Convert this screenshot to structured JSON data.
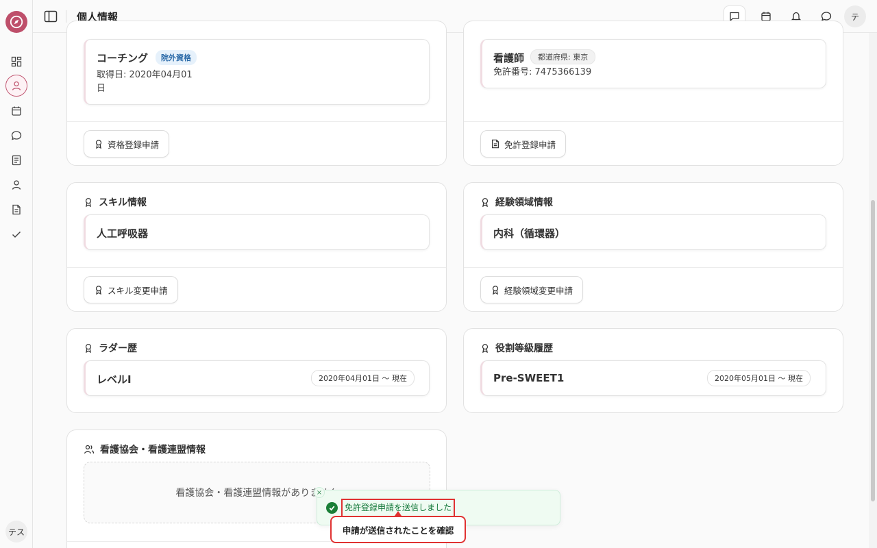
{
  "header": {
    "title": "個人情報",
    "user_initial": "テ"
  },
  "sidebar": {
    "user_label": "テス",
    "items": [
      {
        "icon": "dashboard-icon"
      },
      {
        "icon": "user-icon",
        "active": true
      },
      {
        "icon": "calendar-icon"
      },
      {
        "icon": "chat-icon"
      },
      {
        "icon": "book-icon"
      },
      {
        "icon": "person-icon"
      },
      {
        "icon": "document-icon"
      },
      {
        "icon": "check-icon"
      }
    ]
  },
  "cards": {
    "qualification": {
      "item_title": "コーチング",
      "badge": "院外資格",
      "date_line1": "取得日: 2020年04月01",
      "date_line2": "日",
      "button": "資格登録申請"
    },
    "license": {
      "item_title": "看護師",
      "badge": "都道府県: 東京",
      "number": "免許番号: 7475366139",
      "button": "免許登録申請"
    },
    "skill": {
      "title": "スキル情報",
      "item": "人工呼吸器",
      "button": "スキル変更申請"
    },
    "experience": {
      "title": "経験領域情報",
      "item": "内科（循環器）",
      "button": "経験領域変更申請"
    },
    "ladder": {
      "title": "ラダー歴",
      "item": "レベルI",
      "date": "2020年04月01日 〜 現在"
    },
    "role": {
      "title": "役割等級履歴",
      "item": "Pre-SWEET1",
      "date": "2020年05月01日 〜 現在"
    },
    "association": {
      "title": "看護協会・看護連盟情報",
      "empty": "看護協会・看護連盟情報がありません"
    }
  },
  "toast": {
    "message": "免許登録申請を送信しました",
    "close": "×"
  },
  "tooltip": {
    "text": "申請が送信されたことを確認"
  },
  "colors": {
    "brand": "#be4f6a",
    "success": "#1a7f37",
    "highlight": "#e03131"
  }
}
